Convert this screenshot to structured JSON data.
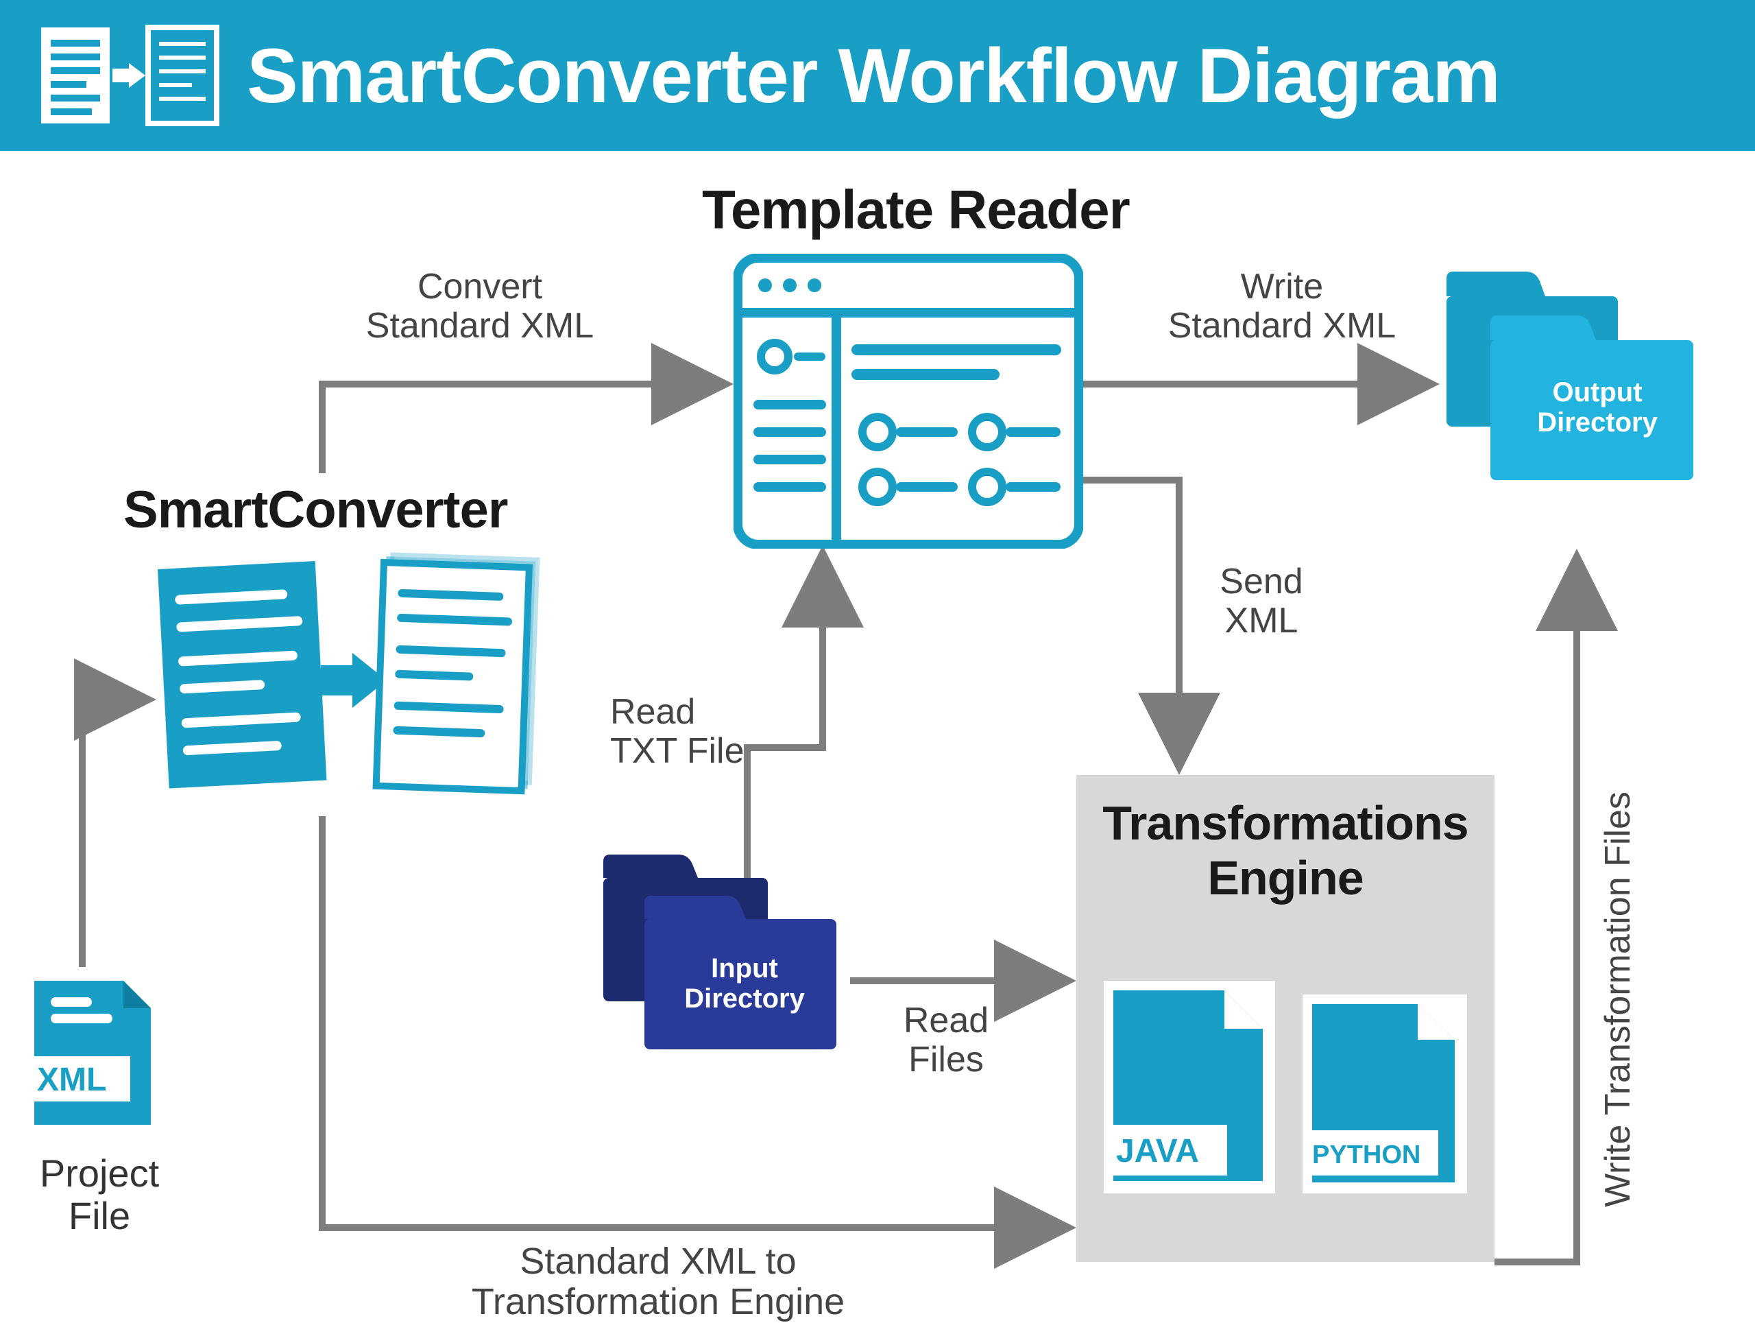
{
  "header": {
    "title": "SmartConverter Workflow Diagram"
  },
  "nodes": {
    "smartconverter": "SmartConverter",
    "template_reader": "Template Reader",
    "input_dir": "Input\nDirectory",
    "output_dir": "Output\nDirectory",
    "transform_engine": "Transformations\nEngine",
    "project_file": "Project\nFile",
    "xml_tag": "XML",
    "java_tag": "JAVA",
    "python_tag": "PYTHON"
  },
  "edges": {
    "convert_std_xml": "Convert\nStandard XML",
    "write_std_xml": "Write\nStandard XML",
    "send_xml": "Send\nXML",
    "read_txt": "Read\nTXT File",
    "read_files": "Read\nFiles",
    "std_xml_to_engine": "Standard XML to\nTransformation Engine",
    "write_transform_files": "Write Transformation Files"
  },
  "colors": {
    "brand": "#199fc6",
    "navy": "#1e2a6e",
    "grey_arrow": "#7d7d7d",
    "grey_box": "#d8d8d8"
  }
}
